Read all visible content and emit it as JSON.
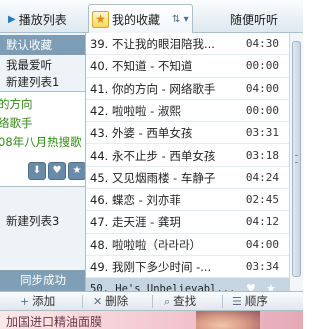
{
  "tabs": {
    "playlist_label": "播放列表",
    "favorites_label": "我的收藏",
    "random_label": "随便听听"
  },
  "sidebar": {
    "items": [
      {
        "label": "默认收藏"
      },
      {
        "label": "我最爱听"
      },
      {
        "label": "新建列表1"
      }
    ],
    "panel_lines": [
      "的方向",
      "络歌手",
      "08年八月热搜歌"
    ],
    "new_list3": "新建列表3",
    "sync_status": "同步成功"
  },
  "songs": [
    {
      "title": "39. 不让我的眼泪陪我...",
      "duration": "04:30"
    },
    {
      "title": "40. 不知道 - 不知道",
      "duration": "00:00"
    },
    {
      "title": "41. 你的方向 - 网络歌手",
      "duration": "04:00"
    },
    {
      "title": "42. 啦啦啦 - 淑熙",
      "duration": "00:00"
    },
    {
      "title": "43. 外婆 - 西单女孩",
      "duration": "03:31"
    },
    {
      "title": "44. 永不止步 - 西单女孩",
      "duration": "03:18"
    },
    {
      "title": "45. 又见烟雨楼 - 车静子",
      "duration": "04:24"
    },
    {
      "title": "46. 蝶恋 - 刘亦菲",
      "duration": "02:45"
    },
    {
      "title": "47. 走天涯 - 龚玥",
      "duration": "04:12"
    },
    {
      "title": "48. 啦啦啦（라라라）",
      "duration": "04:00"
    },
    {
      "title": "49. 我刚下多少时间 -...",
      "duration": "03:34"
    },
    {
      "title": "50. He's Unbelievabl...",
      "duration": ""
    }
  ],
  "toolbar": {
    "add": "添加",
    "delete": "删除",
    "find": "查找",
    "order": "顺序"
  },
  "ad": {
    "text": "加国进口精油面膜"
  },
  "icons": {
    "favorites_tab": "star-icon",
    "sort": "sort-icon",
    "selected_row_actions": [
      "heart-icon",
      "star-icon"
    ],
    "panel_buttons": [
      "download-icon",
      "heart-icon",
      "star-icon"
    ]
  },
  "colors": {
    "selected_sidebar": "#7d9db6",
    "selected_row": "#c6d5e2",
    "panel_text": "#2e8a12",
    "star": "#e08f00"
  }
}
